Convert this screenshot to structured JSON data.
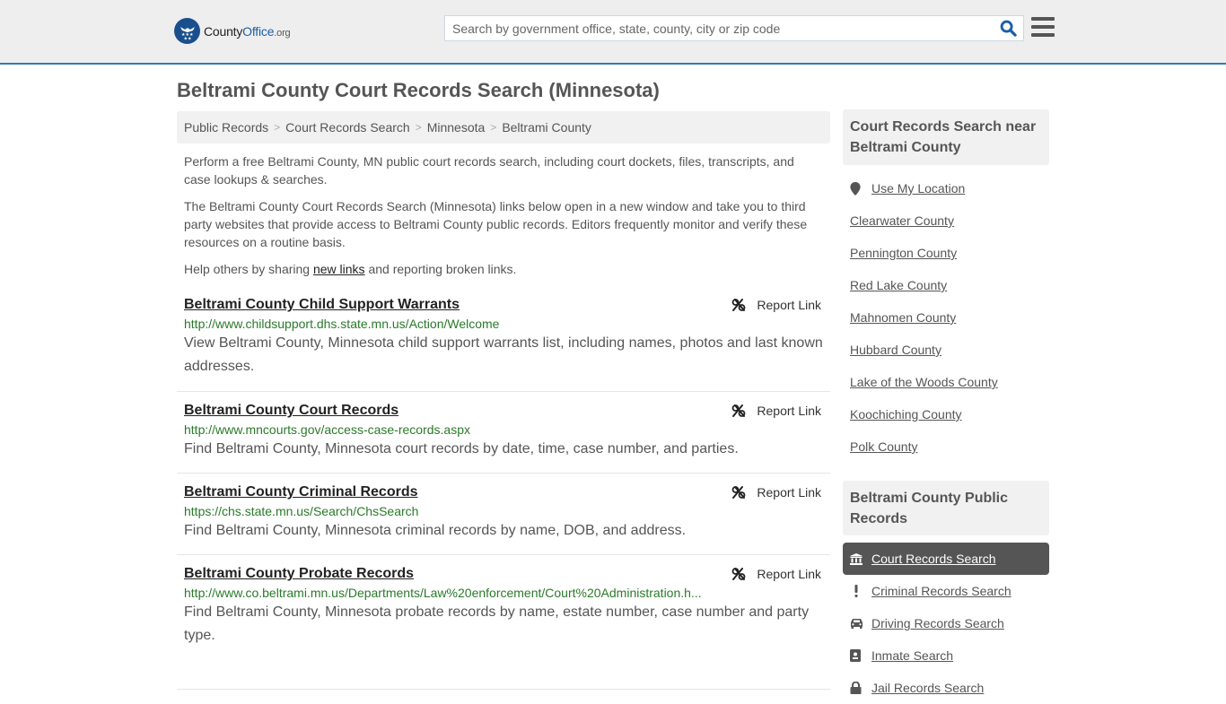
{
  "header": {
    "logo": {
      "county": "County",
      "office": "Office",
      "tld": ".org"
    },
    "search": {
      "placeholder": "Search by government office, state, county, city or zip code",
      "value": ""
    },
    "icons": {
      "search": "search-icon",
      "menu": "hamburger-menu-icon"
    }
  },
  "page": {
    "title": "Beltrami County Court Records Search (Minnesota)"
  },
  "breadcrumb": [
    {
      "label": "Public Records"
    },
    {
      "label": "Court Records Search"
    },
    {
      "label": "Minnesota"
    },
    {
      "label": "Beltrami County"
    }
  ],
  "breadcrumb_separator": ">",
  "intro": {
    "p1": "Perform a free Beltrami County, MN public court records search, including court dockets, files, transcripts, and case lookups & searches.",
    "p2": "The Beltrami County Court Records Search (Minnesota) links below open in a new window and take you to third party websites that provide access to Beltrami County public records. Editors frequently monitor and verify these resources on a routine basis.",
    "p3_before": "Help others by sharing ",
    "p3_link": "new links",
    "p3_after": " and reporting broken links."
  },
  "results": [
    {
      "title": "Beltrami County Child Support Warrants",
      "url": "http://www.childsupport.dhs.state.mn.us/Action/Welcome",
      "description": "View Beltrami County, Minnesota child support warrants list, including names, photos and last known addresses.",
      "report_label": "Report Link"
    },
    {
      "title": "Beltrami County Court Records",
      "url": "http://www.mncourts.gov/access-case-records.aspx",
      "description": "Find Beltrami County, Minnesota court records by date, time, case number, and parties.",
      "report_label": "Report Link"
    },
    {
      "title": "Beltrami County Criminal Records",
      "url": "https://chs.state.mn.us/Search/ChsSearch",
      "description": "Find Beltrami County, Minnesota criminal records by name, DOB, and address.",
      "report_label": "Report Link"
    },
    {
      "title": "Beltrami County Probate Records",
      "url": "http://www.co.beltrami.mn.us/Departments/Law%20enforcement/Court%20Administration.h...",
      "description": "Find Beltrami County, Minnesota probate records by name, estate number, case number and party type.",
      "report_label": "Report Link"
    }
  ],
  "sidebar": {
    "nearby": {
      "heading": "Court Records Search near Beltrami County",
      "use_location": "Use My Location",
      "counties": [
        "Clearwater County",
        "Pennington County",
        "Red Lake County",
        "Mahnomen County",
        "Hubbard County",
        "Lake of the Woods County",
        "Koochiching County",
        "Polk County"
      ]
    },
    "public_records": {
      "heading": "Beltrami County Public Records",
      "items": [
        {
          "label": "Court Records Search",
          "icon": "courthouse-icon",
          "active": true
        },
        {
          "label": "Criminal Records Search",
          "icon": "exclamation-icon",
          "active": false
        },
        {
          "label": "Driving Records Search",
          "icon": "car-icon",
          "active": false
        },
        {
          "label": "Inmate Search",
          "icon": "id-badge-icon",
          "active": false
        },
        {
          "label": "Jail Records Search",
          "icon": "lock-icon",
          "active": false
        }
      ]
    }
  },
  "colors": {
    "header_bg": "#eeeeee",
    "header_border": "#337ab7",
    "brand_blue": "#1a4f8e",
    "url_green": "#2a7a2a",
    "active_nav_bg": "#555555"
  }
}
